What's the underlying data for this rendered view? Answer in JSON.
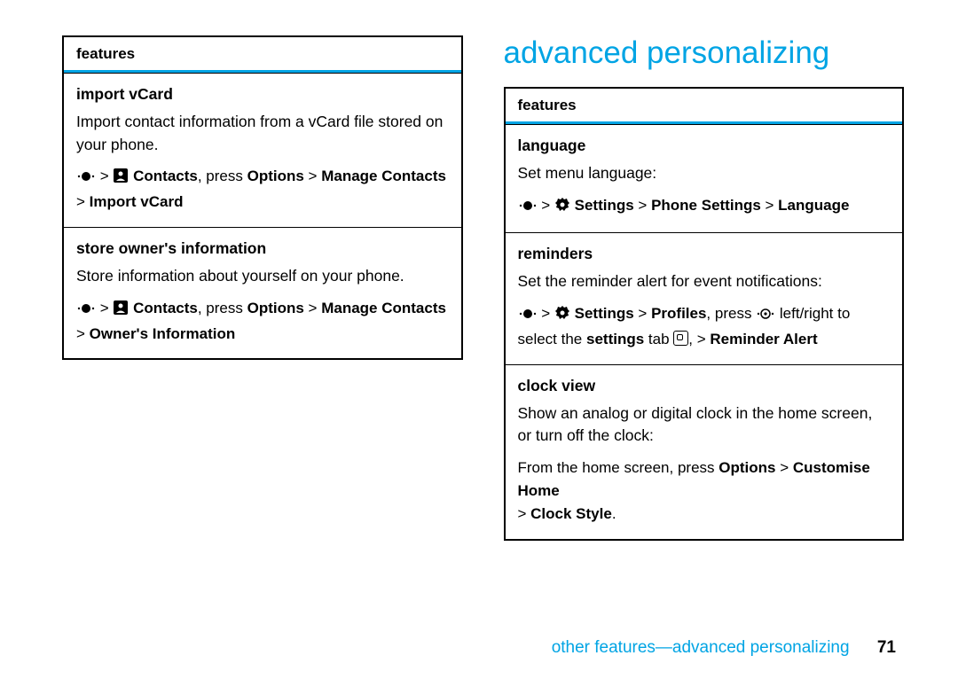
{
  "left_table": {
    "header": "features",
    "rows": [
      {
        "title": "import vCard",
        "desc": "Import contact information from a vCard file stored on your phone."
      },
      {
        "title": "store owner's information",
        "desc": "Store information about yourself on your phone."
      }
    ]
  },
  "right_section_title": "advanced personalizing",
  "right_table": {
    "header": "features",
    "rows": [
      {
        "title": "language",
        "desc": "Set menu language:"
      },
      {
        "title": "reminders",
        "desc": "Set the reminder alert for event notifications:"
      },
      {
        "title": "clock view",
        "desc": "Show an analog or digital clock in the home screen, or turn off the clock:"
      }
    ]
  },
  "nav": {
    "contacts": "Contacts",
    "press": ", press ",
    "options": "Options",
    "gt": " > ",
    "manage_contacts": "Manage Contacts",
    "import_vcard": "Import vCard",
    "owners_info": "Owner's Information",
    "settings": "Settings",
    "phone_settings": "Phone Settings",
    "language": "Language",
    "profiles": "Profiles",
    "left_right": " left/right to select the ",
    "settings_word": "settings",
    "tab_word": " tab ",
    "reminder_alert": "Reminder Alert",
    "from_home": "From the home screen, press ",
    "customise_home": "Customise Home",
    "clock_style": "Clock Style",
    "period": "."
  },
  "footer": {
    "text": "other features—advanced personalizing",
    "page": "71"
  }
}
